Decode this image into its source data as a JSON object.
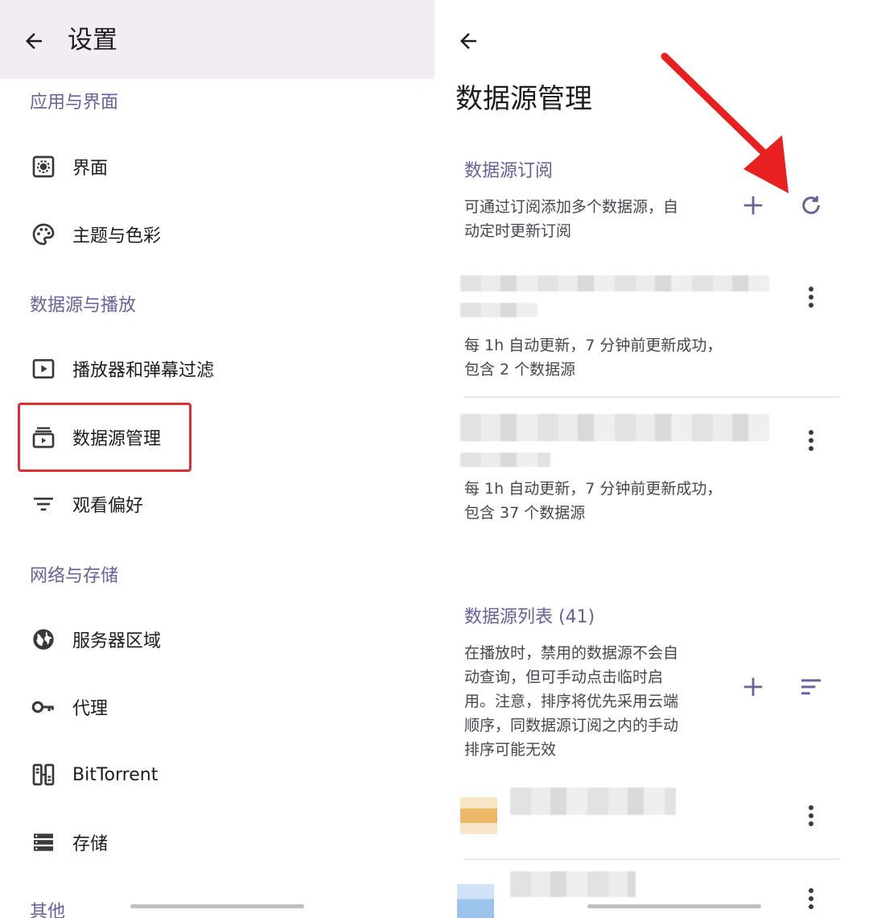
{
  "left": {
    "header_title": "设置",
    "sections": [
      {
        "title": "应用与界面"
      },
      {
        "title": "数据源与播放"
      },
      {
        "title": "网络与存储"
      },
      {
        "title": "其他"
      }
    ],
    "items": [
      {
        "label": "界面",
        "icon": "settings-box-icon"
      },
      {
        "label": "主题与色彩",
        "icon": "palette-icon"
      },
      {
        "label": "播放器和弹幕过滤",
        "icon": "play-box-icon"
      },
      {
        "label": "数据源管理",
        "icon": "source-stack-icon"
      },
      {
        "label": "观看偏好",
        "icon": "filter-lines-icon"
      },
      {
        "label": "服务器区域",
        "icon": "globe-icon"
      },
      {
        "label": "代理",
        "icon": "key-icon"
      },
      {
        "label": "BitTorrent",
        "icon": "network-icon"
      },
      {
        "label": "存储",
        "icon": "storage-icon"
      }
    ]
  },
  "right": {
    "title": "数据源管理",
    "subscriptions": {
      "header": "数据源订阅",
      "description_lines": [
        "可通过订阅添加多个数据源，自",
        "动定时更新订阅"
      ],
      "items": [
        {
          "meta_lines": [
            "每 1h 自动更新，7 分钟前更新成功，",
            "包含 2 个数据源"
          ]
        },
        {
          "meta_lines": [
            "每 1h 自动更新，7 分钟前更新成功，",
            "包含 37 个数据源"
          ]
        }
      ]
    },
    "sources": {
      "header": "数据源列表 (41)",
      "description_lines": [
        "在播放时，禁用的数据源不会自",
        "动查询，但可手动点击临时启",
        "用。注意，排序将优先采用云端",
        "顺序，同数据源订阅之内的手动",
        "排序可能无效"
      ]
    },
    "colors": {
      "accent": "#6a5f9b",
      "annotation": "#e8201f"
    }
  }
}
